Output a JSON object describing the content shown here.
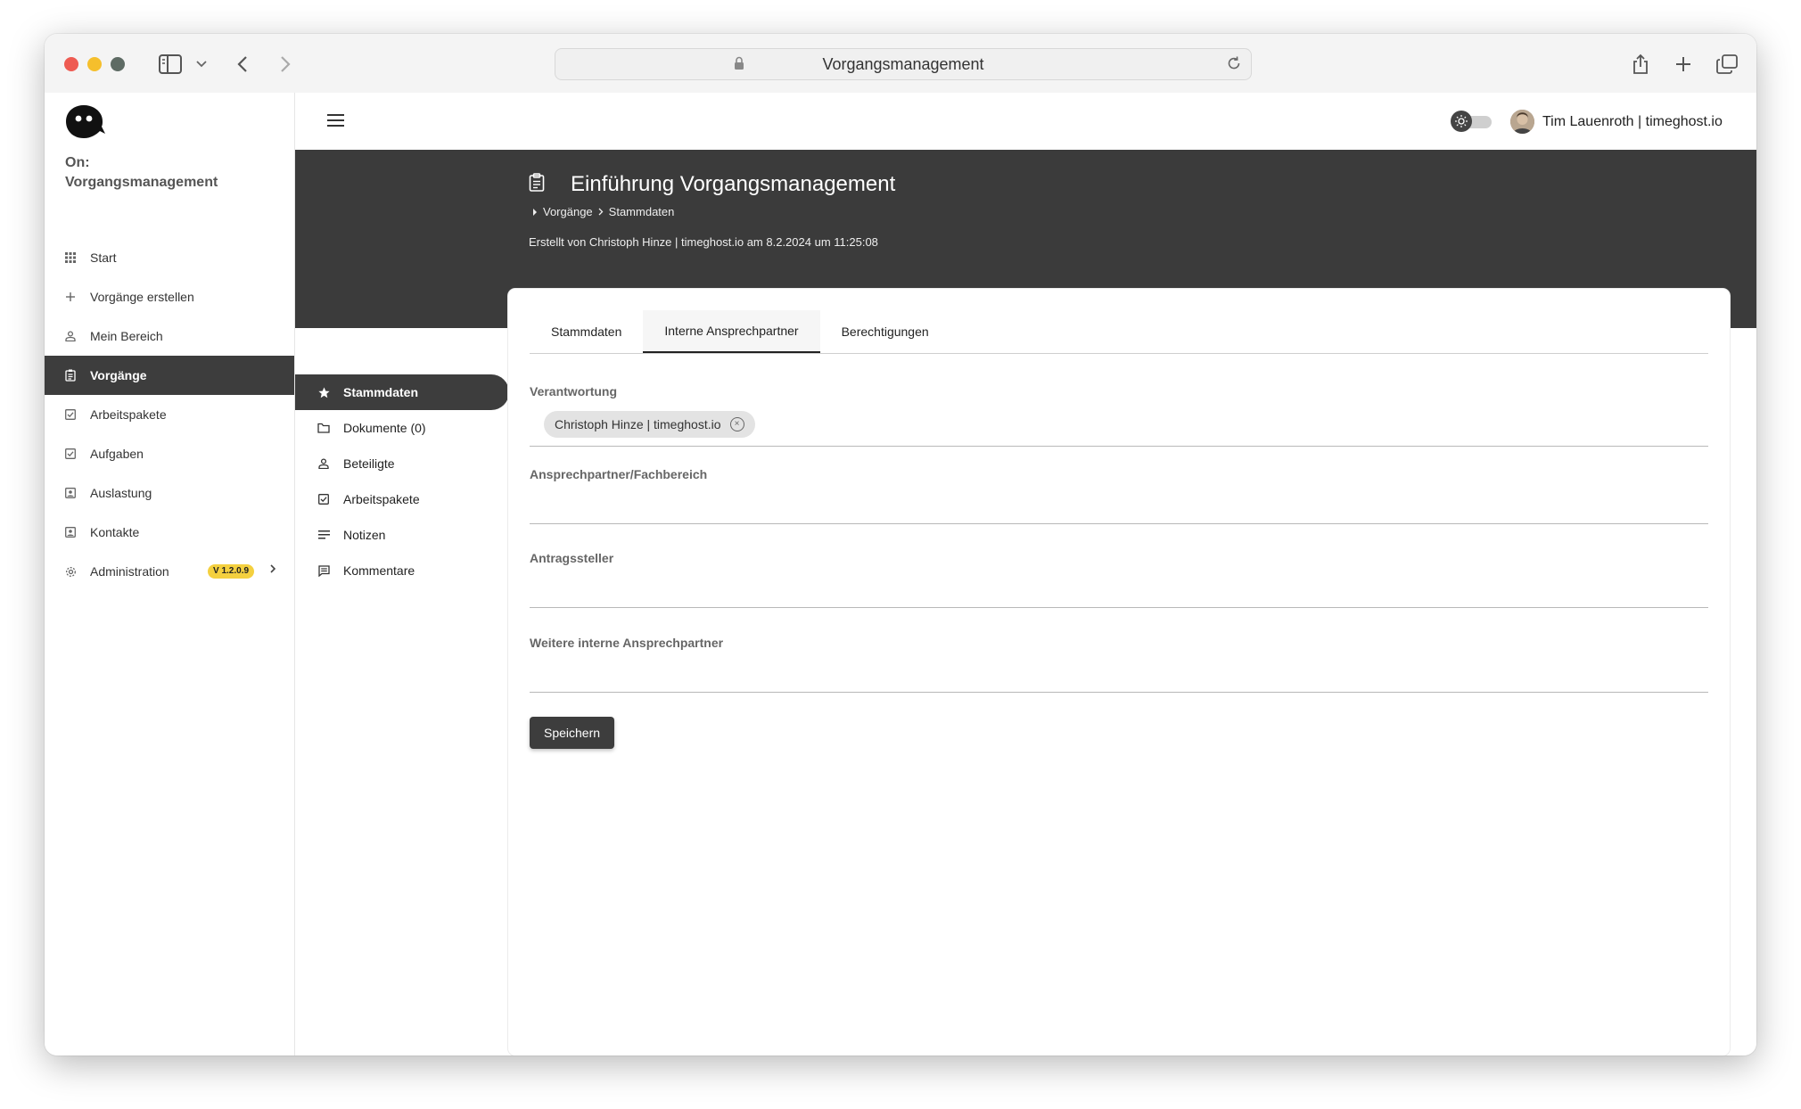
{
  "browser": {
    "address": "Vorgangsmanagement"
  },
  "sidebar": {
    "app_title_line1": "On:",
    "app_title_line2": "Vorgangsmanagement",
    "items": [
      {
        "label": "Start",
        "icon": "grid-icon"
      },
      {
        "label": "Vorgänge erstellen",
        "icon": "plus-icon"
      },
      {
        "label": "Mein Bereich",
        "icon": "person-icon"
      },
      {
        "label": "Vorgänge",
        "icon": "clipboard-icon",
        "active": true
      },
      {
        "label": "Arbeitspakete",
        "icon": "checkbox-icon"
      },
      {
        "label": "Aufgaben",
        "icon": "checkbox-icon"
      },
      {
        "label": "Auslastung",
        "icon": "contact-card-icon"
      },
      {
        "label": "Kontakte",
        "icon": "contact-card-icon"
      },
      {
        "label": "Administration",
        "icon": "gear-icon"
      }
    ],
    "version_badge": "V 1.2.0.9"
  },
  "topbar": {
    "user": "Tim Lauenroth | timeghost.io"
  },
  "hero": {
    "title": "Einführung Vorgangsmanagement",
    "breadcrumb": [
      "Vorgänge",
      "Stammdaten"
    ],
    "created": "Erstellt von Christoph Hinze | timeghost.io am 8.2.2024 um 11:25:08"
  },
  "subnav": [
    {
      "label": "Stammdaten",
      "icon": "star-icon",
      "active": true
    },
    {
      "label": "Dokumente (0)",
      "icon": "folder-icon"
    },
    {
      "label": "Beteiligte",
      "icon": "person-icon"
    },
    {
      "label": "Arbeitspakete",
      "icon": "checkbox-icon"
    },
    {
      "label": "Notizen",
      "icon": "notes-icon"
    },
    {
      "label": "Kommentare",
      "icon": "comment-icon"
    }
  ],
  "tabs": [
    {
      "label": "Stammdaten"
    },
    {
      "label": "Interne Ansprechpartner",
      "active": true
    },
    {
      "label": "Berechtigungen"
    }
  ],
  "form": {
    "verantwortung_label": "Verantwortung",
    "verantwortung_chip": "Christoph Hinze | timeghost.io",
    "ansprechpartner_label": "Ansprechpartner/Fachbereich",
    "antragsteller_label": "Antragssteller",
    "weitere_label": "Weitere interne Ansprechpartner",
    "save_label": "Speichern"
  },
  "colors": {
    "dark": "#3b3b3b",
    "badge": "#f4d03f"
  }
}
